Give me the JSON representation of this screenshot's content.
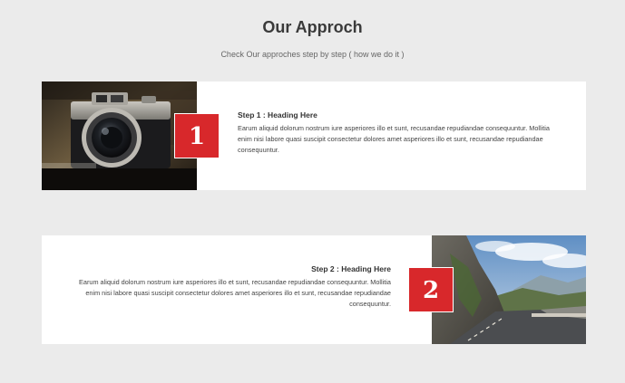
{
  "header": {
    "title": "Our Approch",
    "subtitle": "Check Our approches step by step ( how we do it )"
  },
  "steps": [
    {
      "number": "1",
      "heading": "Step 1 : Heading Here",
      "body": "Earum aliquid dolorum nostrum iure asperiores illo et sunt, recusandae repudiandae consequuntur. Mollitia enim nisi labore quasi suscipit consectetur dolores amet asperiores illo et sunt, recusandae repudiandae consequuntur.",
      "image": "vintage-camera-photo"
    },
    {
      "number": "2",
      "heading": "Step 2 : Heading Here",
      "body": "Earum aliquid dolorum nostrum iure asperiores illo et sunt, recusandae repudiandae consequuntur. Mollitia enim nisi labore quasi suscipit consectetur dolores amet asperiores illo et sunt, recusandae repudiandae consequuntur.",
      "image": "mountain-road-photo"
    }
  ],
  "colors": {
    "background": "#ebebeb",
    "card": "#ffffff",
    "accent": "#d8282b"
  }
}
